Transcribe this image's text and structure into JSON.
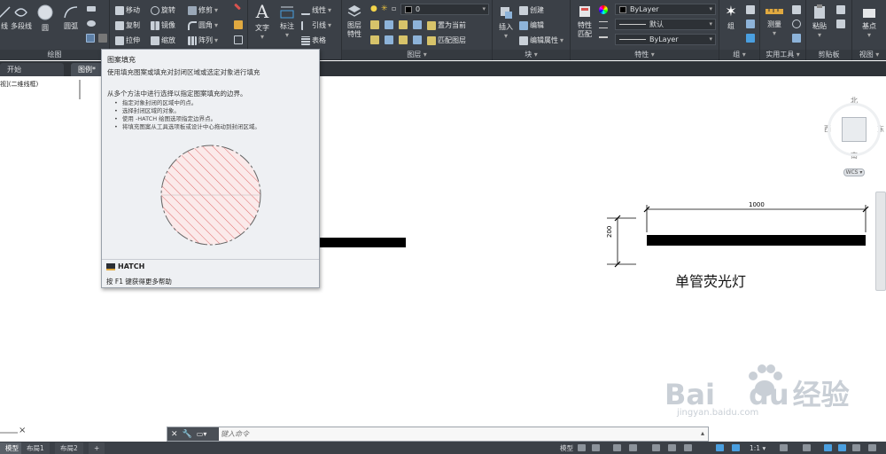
{
  "ribbon": {
    "draw": {
      "title": "绘图",
      "line": "线",
      "polyline": "多段线",
      "circle": "圆",
      "arc": "圆弧"
    },
    "modify": {
      "move": "移动",
      "rotate": "旋转",
      "trim": "修剪",
      "copy": "复制",
      "mirror": "镜像",
      "fillet": "圆角",
      "stretch": "拉伸",
      "scale": "缩放",
      "array": "阵列"
    },
    "annotation": {
      "text": "文字",
      "dimension": "标注",
      "linear": "线性",
      "leader": "引线",
      "table": "表格"
    },
    "layers": {
      "title": "图层",
      "properties": "图层\n特性",
      "layer_value": "0",
      "set_current": "置为当前",
      "match_layer": "匹配图层"
    },
    "block": {
      "title": "块",
      "insert": "插入",
      "create": "创建",
      "edit": "编辑",
      "edit_attr": "编辑属性"
    },
    "properties": {
      "title": "特性",
      "match": "特性\n匹配",
      "color": "ByLayer",
      "linetype": "默认",
      "lineweight": "ByLayer"
    },
    "groups": {
      "title": "组",
      "group": "组"
    },
    "utilities": {
      "title": "实用工具",
      "measure": "测量"
    },
    "clipboard": {
      "title": "剪贴板",
      "paste": "粘贴"
    },
    "view": {
      "title": "视图",
      "base": "基点"
    },
    "colors": {
      "bg": "#3b4047",
      "accent": "#4a9fe0"
    }
  },
  "tabs": {
    "start": "开始",
    "drawing": "图例*"
  },
  "canvas": {
    "view_label": "视](二维线框)",
    "dim_width": "1000",
    "dim_height": "200",
    "fixture_label": "单管荧光灯"
  },
  "tooltip": {
    "title": "图案填充",
    "description": "使用填充图案或填充对封闭区域或选定对象进行填充",
    "intro": "从多个方法中进行选择以指定图案填充的边界。",
    "bullets": [
      "指定对象封闭的区域中的点。",
      "选择封闭区域的对象。",
      "使用 -HATCH 绘图选项指定边界点。",
      "将填充图案从工具选项板或设计中心拖动到封闭区域。"
    ],
    "command": "HATCH",
    "help": "按 F1 键获得更多帮助"
  },
  "viewcube": {
    "north": "北",
    "south": "南",
    "east": "东",
    "west": "西",
    "wcs": "WCS"
  },
  "commandline": {
    "placeholder": "键入命令"
  },
  "statusbar": {
    "model": "模型",
    "layout1": "布局1",
    "layout2": "布局2",
    "add": "+",
    "model_right": "模型",
    "scale": "1:1"
  },
  "watermark": {
    "brand": "Bai",
    "brand2": "du",
    "cn": "经验",
    "url": "jingyan.baidu.com"
  }
}
